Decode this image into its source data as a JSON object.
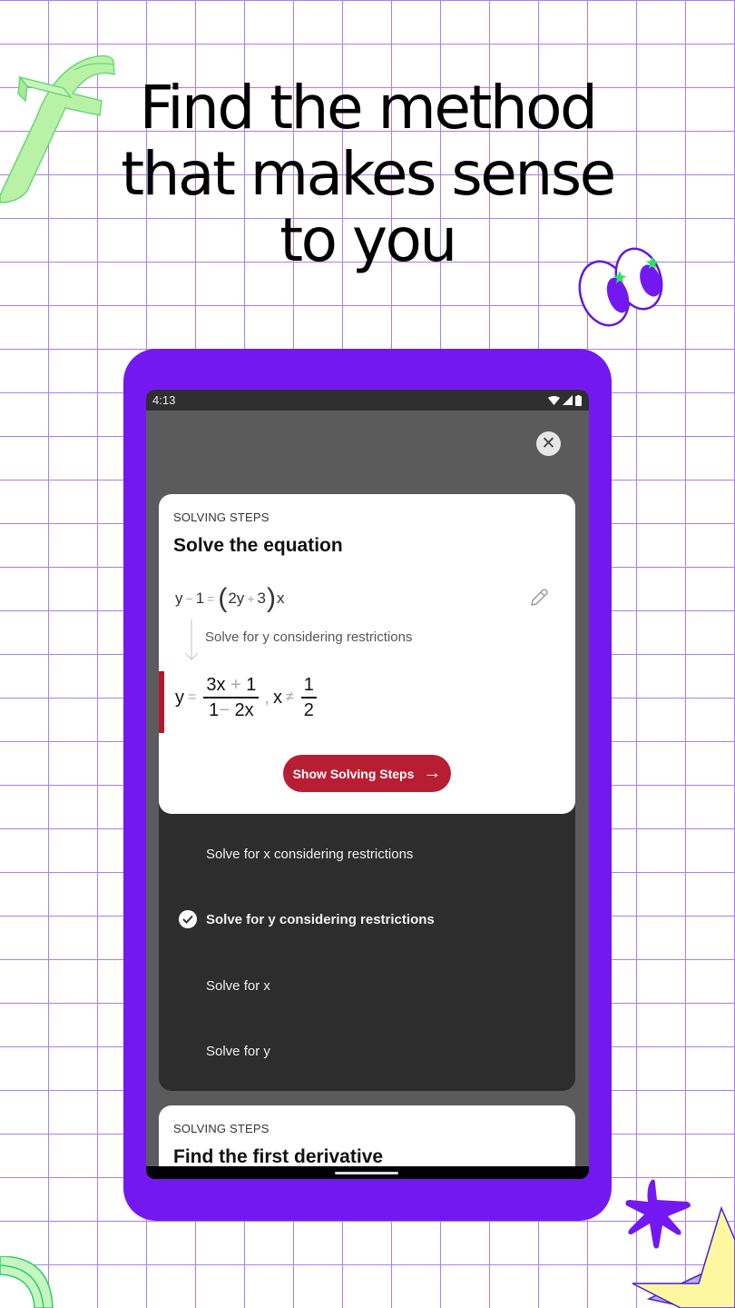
{
  "headline": {
    "line1": "Find the method",
    "line2": "that makes sense",
    "line3": "to you"
  },
  "colors": {
    "phone_frame": "#7418f2",
    "grid": "#a97ef0",
    "accent_red": "#b81e33",
    "screen_overlay": "#5b5b5b",
    "panel": "#2d2d2d"
  },
  "statusbar": {
    "time": "4:13",
    "icons": [
      "wifi-icon",
      "signal-icon",
      "battery-icon"
    ]
  },
  "close_button": {
    "icon": "close-icon",
    "label": "✕"
  },
  "card": {
    "eyebrow": "SOLVING STEPS",
    "title": "Solve the equation",
    "equation": {
      "lhs_var": "y",
      "minus": "−",
      "one": "1",
      "equals": "=",
      "open_paren": "(",
      "inner_a": "2y",
      "plus": "+",
      "inner_b": "3",
      "close_paren": ")",
      "rhs_var": "x"
    },
    "step_label": "Solve for y considering restrictions",
    "result": {
      "lhs": "y",
      "equals": "=",
      "numerator_a": "3x",
      "numerator_op": "+",
      "numerator_b": "1",
      "denominator_a": "1",
      "denominator_op": "−",
      "denominator_b": "2x",
      "comma": ",",
      "cond_var": "x",
      "neq": "≠",
      "cond_num": "1",
      "cond_den": "2"
    },
    "show_steps_button": "Show Solving Steps",
    "arrow": "→"
  },
  "options": [
    {
      "label": "Solve for x considering restrictions",
      "selected": false
    },
    {
      "label": "Solve for y considering restrictions",
      "selected": true
    },
    {
      "label": "Solve for x",
      "selected": false
    },
    {
      "label": "Solve for y",
      "selected": false
    }
  ],
  "next_card": {
    "eyebrow": "SOLVING STEPS",
    "title": "Find the first derivative"
  }
}
